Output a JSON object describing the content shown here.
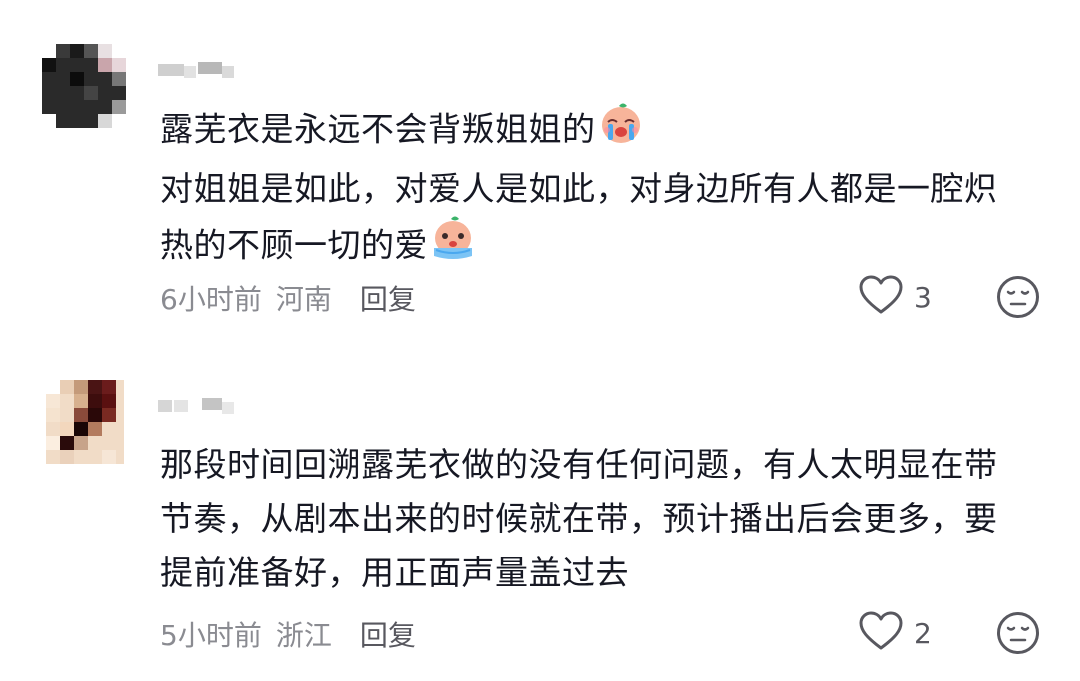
{
  "comments": [
    {
      "text_lines": [
        "露芜衣是永远不会背叛姐姐的",
        "对姐姐是如此，对爱人是如此，对身边所有人都是一腔炽",
        "热的不顾一切的爱"
      ],
      "emoji_1": "crying-face-emoji",
      "emoji_2": "sobbing-face-emoji",
      "time": "6小时前",
      "location": "河南",
      "reply_label": "回复",
      "likes": "3"
    },
    {
      "text_lines": [
        "那段时间回溯露芜衣做的没有任何问题，有人太明显在带",
        "节奏，从剧本出来的时候就在带，预计播出后会更多，要",
        "提前准备好，用正面声量盖过去"
      ],
      "time": "5小时前",
      "location": "浙江",
      "reply_label": "回复",
      "likes": "2"
    }
  ],
  "icons": {
    "like": "heart-outline-icon",
    "dislike": "neutral-face-icon"
  },
  "colors": {
    "text": "#161823",
    "meta": "#8a8b91",
    "action": "#58585f"
  }
}
